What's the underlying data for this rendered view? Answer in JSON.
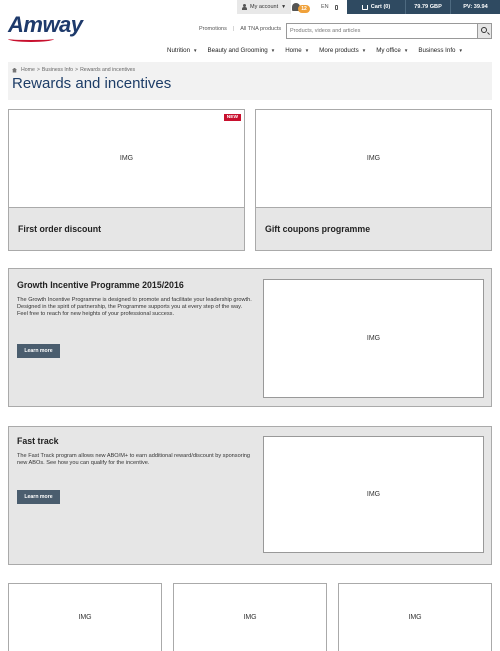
{
  "header": {
    "logo": "Amway",
    "account_label": "My account",
    "notification_count": "12",
    "lang": "EN",
    "cart_label": "Cart (0)",
    "cart_total": "79.79 GBP",
    "pv_label": "PV: 39.94",
    "promotions": "Promotions",
    "all_tna": "All TNA products",
    "search_placeholder": "Products, videos and articles"
  },
  "nav": {
    "items": [
      {
        "label": "Nutrition"
      },
      {
        "label": "Beauty and Grooming"
      },
      {
        "label": "Home"
      },
      {
        "label": "More products"
      },
      {
        "label": "My office"
      },
      {
        "label": "Business Info"
      }
    ]
  },
  "page": {
    "breadcrumb": [
      "Home",
      "Business Info",
      "Rewards and incentives"
    ],
    "title": "Rewards and incentives"
  },
  "cards": [
    {
      "img": "IMG",
      "title": "First order discount",
      "badge": "NEW"
    },
    {
      "img": "IMG",
      "title": "Gift coupons programme"
    }
  ],
  "promos": [
    {
      "title": "Growth Incentive Programme 2015/2016",
      "text": "The Growth Incentive Programme is designed to promote and facilitate your leadership growth. Designed in the spirit of partnership, the Programme supports you at every step of the way. Feel free to reach for new heights of your professional success.",
      "button": "Learn more",
      "img": "IMG"
    },
    {
      "title": "Fast track",
      "text": "The Fast Track program allows new ABO/M+ to earn additional reward/discount by sponsoring new ABOs. See how you can qualify for the incentive.",
      "button": "Learn more",
      "img": "IMG"
    }
  ],
  "tiles": [
    "IMG",
    "IMG",
    "IMG"
  ]
}
